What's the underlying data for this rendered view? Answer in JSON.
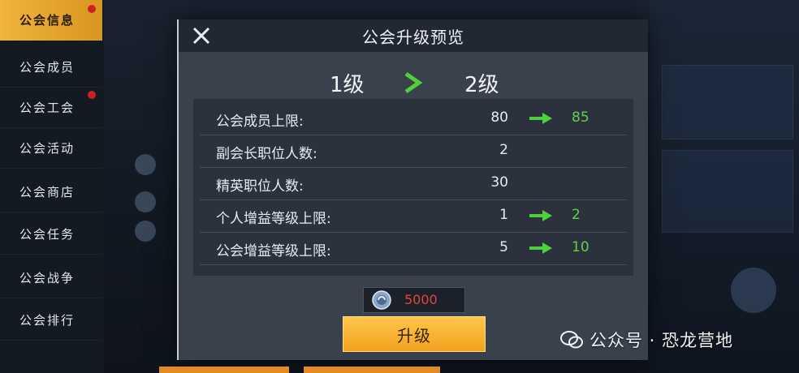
{
  "sidebar": {
    "items": [
      {
        "label": "公会信息",
        "active": true
      },
      {
        "label": "公会成员"
      },
      {
        "label": "公会工会"
      },
      {
        "label": "公会活动"
      },
      {
        "label": "公会商店"
      },
      {
        "label": "公会任务"
      },
      {
        "label": "公会战争"
      },
      {
        "label": "公会排行"
      }
    ]
  },
  "modal": {
    "title": "公会升级预览",
    "current_level": "1级",
    "next_level": "2级",
    "stats": [
      {
        "label": "公会成员上限:",
        "current": "80",
        "next": "85"
      },
      {
        "label": "副会长职位人数:",
        "current": "2",
        "next": ""
      },
      {
        "label": "精英职位人数:",
        "current": "30",
        "next": ""
      },
      {
        "label": "个人增益等级上限:",
        "current": "1",
        "next": "2"
      },
      {
        "label": "公会增益等级上限:",
        "current": "5",
        "next": "10"
      },
      {
        "label": "",
        "current": "",
        "next": ""
      }
    ],
    "cost": "5000",
    "upgrade_label": "升级"
  },
  "watermark": "公众号 · 恐龙营地",
  "colors": {
    "accent_gold": "#f2a21e",
    "increase_green": "#5fd14a",
    "cost_red": "#e0463e"
  }
}
